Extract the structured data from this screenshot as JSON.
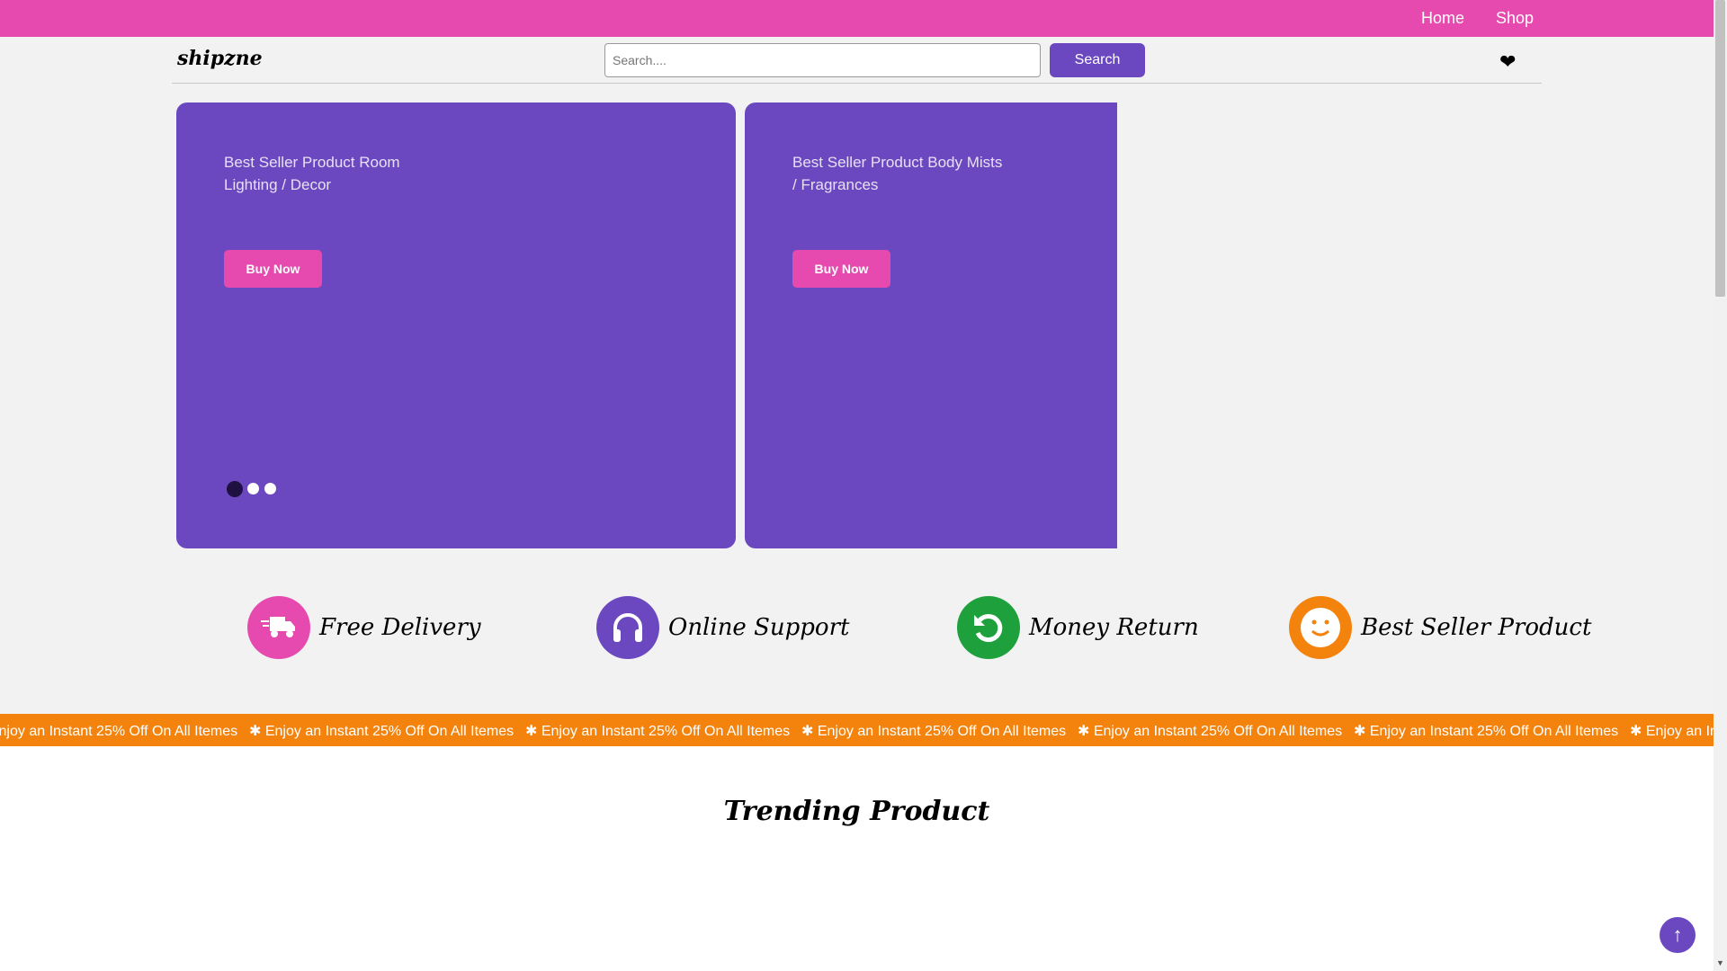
{
  "nav": {
    "home": "Home",
    "shop": "Shop"
  },
  "header": {
    "logo": "shipzne",
    "search_placeholder": "Search....",
    "search_button": "Search"
  },
  "slides": [
    {
      "title": "Best Seller Product Room Lighting / Decor",
      "button": "Buy Now"
    },
    {
      "title": "Best Seller Product Body Mists / Fragrances",
      "button": "Buy Now"
    }
  ],
  "carousel": {
    "count": 3,
    "active": 1
  },
  "features": [
    {
      "label": "Free Delivery",
      "icon": "truck-icon",
      "color": "#e64aae"
    },
    {
      "label": "Online Support",
      "icon": "headphones-icon",
      "color": "#6b48c0"
    },
    {
      "label": "Money Return",
      "icon": "undo-icon",
      "color": "#1ea03c"
    },
    {
      "label": "Best Seller Product",
      "icon": "smile-icon",
      "color": "#f4830e"
    }
  ],
  "marquee": {
    "text": "✱ Enjoy an Instant 25% Off On All Itemes"
  },
  "trending": {
    "title": "Trending Product"
  },
  "colors": {
    "pink": "#e64aae",
    "purple": "#6b48c0",
    "orange": "#f4830e"
  }
}
